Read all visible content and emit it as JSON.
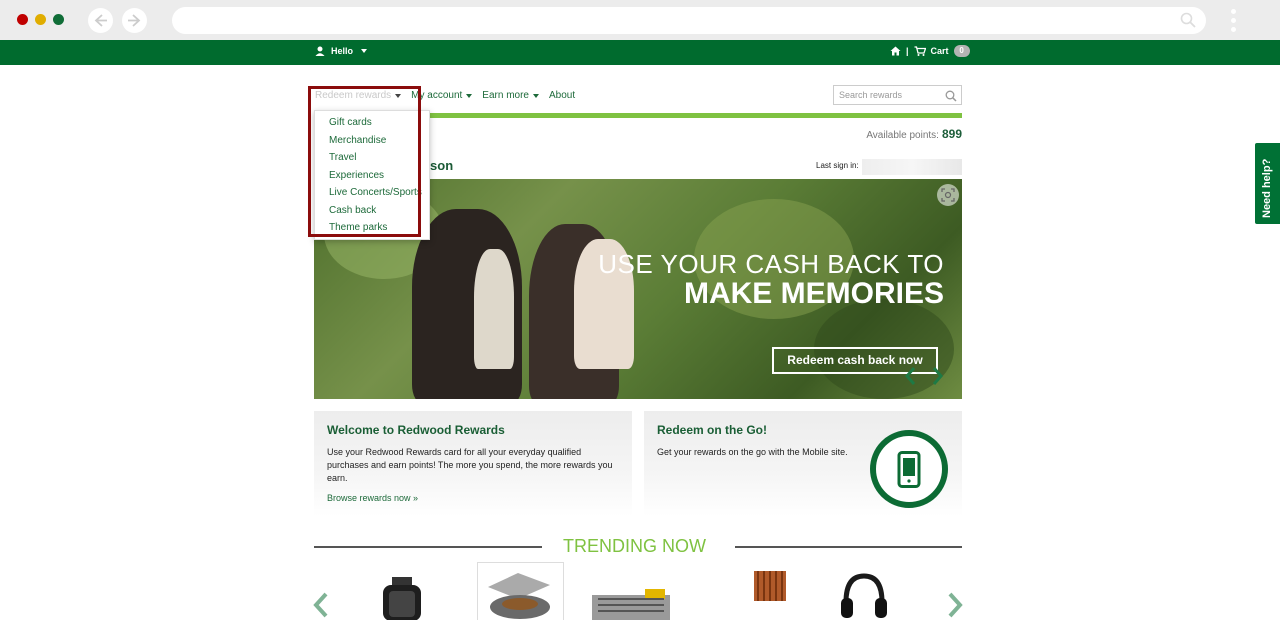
{
  "browser": {
    "dots": [
      "#c00000",
      "#e0ad00",
      "#106d37"
    ],
    "back_icon": "arrow-left-icon",
    "forward_icon": "arrow-right-icon",
    "search_icon": "search-icon"
  },
  "topbar": {
    "hello": "Hello",
    "cart": "Cart",
    "cart_count": "0",
    "separator": "|"
  },
  "nav": {
    "items": [
      "Redeem rewards",
      "My account",
      "Earn more",
      "About"
    ]
  },
  "dropdown": {
    "items": [
      "Gift cards",
      "Merchandise",
      "Travel",
      "Experiences",
      "Live Concerts/Sports",
      "Cash back",
      "Theme parks"
    ]
  },
  "search": {
    "placeholder": "Search rewards"
  },
  "points": {
    "label": "Available points:",
    "value": "899"
  },
  "welcome": {
    "name_fragment": "rson",
    "last_sign_in": "Last sign in:"
  },
  "hero": {
    "line1": "USE YOUR CASH BACK TO",
    "line2": "MAKE MEMORIES",
    "cta": "Redeem cash back now"
  },
  "cards": {
    "welcome": {
      "title": "Welcome to Redwood Rewards",
      "body": "Use your Redwood Rewards card for all your everyday qualified purchases and earn points! The more you spend, the more rewards you earn.",
      "link": "Browse rewards now »"
    },
    "mobile": {
      "title": "Redeem on the Go!",
      "body": "Get your rewards on the go with the Mobile site."
    }
  },
  "trending": {
    "title": "TRENDING NOW"
  },
  "help": {
    "label": "Need help?"
  },
  "colors": {
    "brand_green": "#006b2e",
    "accent_green": "#7fc241",
    "highlight": "#8b0c0c"
  }
}
